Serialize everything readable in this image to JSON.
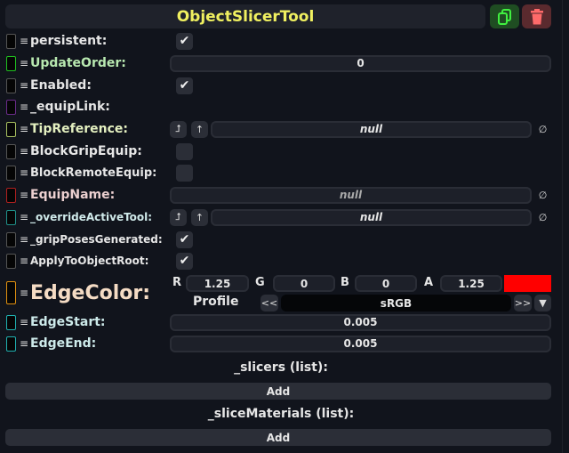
{
  "header": {
    "title": "ObjectSlicerTool",
    "duplicate_icon": "duplicate-icon",
    "delete_icon": "trash-icon",
    "accent": "#f0f060"
  },
  "fields": [
    {
      "label": "persistent:",
      "type": "bool",
      "value": true
    },
    {
      "label": "UpdateOrder:",
      "type": "int",
      "value": "0"
    },
    {
      "label": "Enabled:",
      "type": "bool",
      "value": true
    },
    {
      "label": "_equipLink:",
      "type": "link"
    },
    {
      "label": "TipReference:",
      "type": "ref",
      "value": "null"
    },
    {
      "label": "BlockGripEquip:",
      "type": "bool",
      "value": false
    },
    {
      "label": "BlockRemoteEquip:",
      "type": "bool",
      "value": false
    },
    {
      "label": "EquipName:",
      "type": "string",
      "value": "null"
    },
    {
      "label": "_overrideActiveTool:",
      "type": "ref",
      "value": "null"
    },
    {
      "label": "_gripPosesGenerated:",
      "type": "bool",
      "value": true
    },
    {
      "label": "ApplyToObjectRoot:",
      "type": "bool",
      "value": true
    }
  ],
  "edge_color": {
    "label": "EdgeColor:",
    "r_label": "R",
    "r": "1.25",
    "g_label": "G",
    "g": "0",
    "b_label": "B",
    "b": "0",
    "a_label": "A",
    "a": "1.25",
    "swatch": "#ff0000",
    "profile_label": "Profile",
    "profile": "sRGB",
    "prev": "<<",
    "next": ">>"
  },
  "edge_start": {
    "label": "EdgeStart:",
    "value": "0.005"
  },
  "edge_end": {
    "label": "EdgeEnd:",
    "value": "0.005"
  },
  "lists": [
    {
      "title": "_slicers (list):",
      "add": "Add"
    },
    {
      "title": "_sliceMaterials (list):",
      "add": "Add"
    }
  ]
}
